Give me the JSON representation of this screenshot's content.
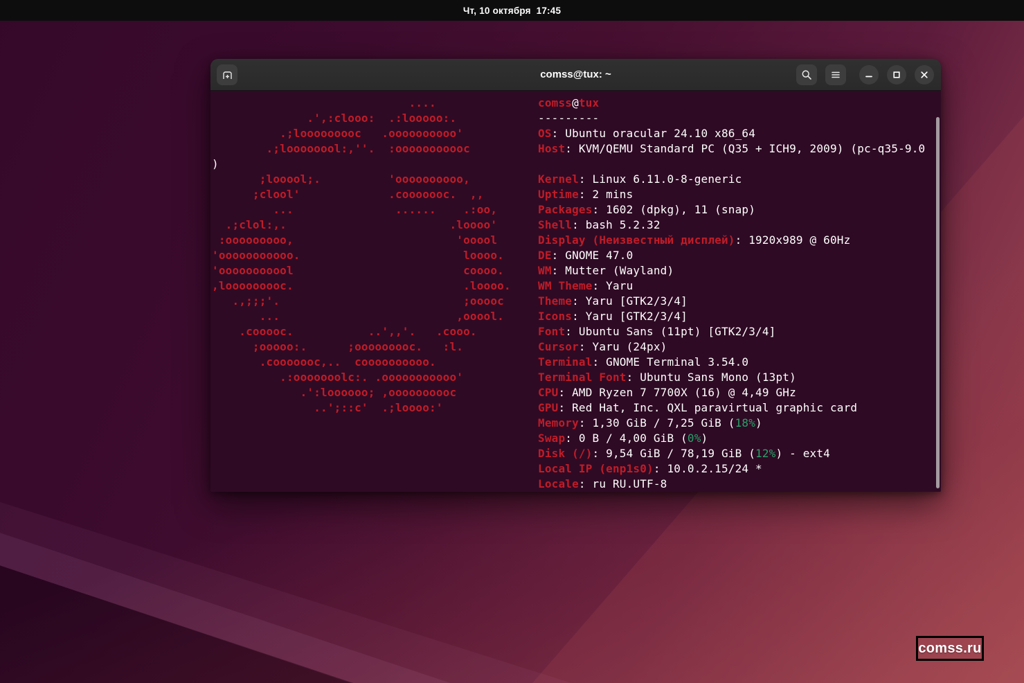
{
  "top_bar": {
    "clock": "Чт, 10 октября  17:45"
  },
  "window": {
    "title": "comss@tux: ~"
  },
  "colors": {
    "terminal_bg": "#2f0a24",
    "ascii_red": "#c01c28",
    "label_red": "#c01c28",
    "foreground": "#ffffff",
    "percent_green": "#26a269",
    "titlebar": "#2c2c2c",
    "topbar": "#0d0d0d"
  },
  "terminal": {
    "host_wrap": ")",
    "ascii_art": [
      "                             ....",
      "              .',:clooo:  .:looooo:.",
      "          .;looooooooc   .oooooooooo'",
      "        .;loooooool:,''.  :ooooooooooc",
      "",
      "       ;looool;.          'oooooooooo,",
      "      ;clool'             .cooooooc.  ,,",
      "         ...               ......    .:oo,",
      "  .;clol:,.                        .loooo'",
      " :ooooooooo,                        'ooool",
      "'ooooooooooo.                        loooo.",
      "'ooooooooool                         coooo.",
      ",looooooooc.                         .loooo.",
      "   .,;;;'.                           ;ooooc",
      "       ...                          ,ooool.",
      "    .cooooc.           ..',,'.   .cooo.",
      "      ;ooooo:.      ;ooooooooc.   :l.",
      "       .cooooooc,..  coooooooooo.",
      "          .:ooooooolc:. .ooooooooooo'",
      "             .':loooooo; ,oooooooooc",
      "               ..';::c'  .;loooo:'"
    ],
    "info_lines": [
      [
        {
          "t": "comss",
          "c": "red"
        },
        {
          "t": "@",
          "c": "fg"
        },
        {
          "t": "tux",
          "c": "red"
        }
      ],
      [
        {
          "t": "---------",
          "c": "fg"
        }
      ],
      [
        {
          "t": "OS",
          "c": "red"
        },
        {
          "t": ": Ubuntu oracular 24.10 x86_64",
          "c": "fg"
        }
      ],
      [
        {
          "t": "Host",
          "c": "red"
        },
        {
          "t": ": KVM/QEMU Standard PC (Q35 + ICH9, 2009) (pc-q35-9.0",
          "c": "fg"
        }
      ],
      [],
      [
        {
          "t": "Kernel",
          "c": "red"
        },
        {
          "t": ": Linux 6.11.0-8-generic",
          "c": "fg"
        }
      ],
      [
        {
          "t": "Uptime",
          "c": "red"
        },
        {
          "t": ": 2 mins",
          "c": "fg"
        }
      ],
      [
        {
          "t": "Packages",
          "c": "red"
        },
        {
          "t": ": 1602 (dpkg), 11 (snap)",
          "c": "fg"
        }
      ],
      [
        {
          "t": "Shell",
          "c": "red"
        },
        {
          "t": ": bash 5.2.32",
          "c": "fg"
        }
      ],
      [
        {
          "t": "Display (Неизвестный дисплей)",
          "c": "red"
        },
        {
          "t": ": 1920x989 @ 60Hz",
          "c": "fg"
        }
      ],
      [
        {
          "t": "DE",
          "c": "red"
        },
        {
          "t": ": GNOME 47.0",
          "c": "fg"
        }
      ],
      [
        {
          "t": "WM",
          "c": "red"
        },
        {
          "t": ": Mutter (Wayland)",
          "c": "fg"
        }
      ],
      [
        {
          "t": "WM Theme",
          "c": "red"
        },
        {
          "t": ": Yaru",
          "c": "fg"
        }
      ],
      [
        {
          "t": "Theme",
          "c": "red"
        },
        {
          "t": ": Yaru [GTK2/3/4]",
          "c": "fg"
        }
      ],
      [
        {
          "t": "Icons",
          "c": "red"
        },
        {
          "t": ": Yaru [GTK2/3/4]",
          "c": "fg"
        }
      ],
      [
        {
          "t": "Font",
          "c": "red"
        },
        {
          "t": ": Ubuntu Sans (11pt) [GTK2/3/4]",
          "c": "fg"
        }
      ],
      [
        {
          "t": "Cursor",
          "c": "red"
        },
        {
          "t": ": Yaru (24px)",
          "c": "fg"
        }
      ],
      [
        {
          "t": "Terminal",
          "c": "red"
        },
        {
          "t": ": GNOME Terminal 3.54.0",
          "c": "fg"
        }
      ],
      [
        {
          "t": "Terminal Font",
          "c": "red"
        },
        {
          "t": ": Ubuntu Sans Mono (13pt)",
          "c": "fg"
        }
      ],
      [
        {
          "t": "CPU",
          "c": "red"
        },
        {
          "t": ": AMD Ryzen 7 7700X (16) @ 4,49 GHz",
          "c": "fg"
        }
      ],
      [
        {
          "t": "GPU",
          "c": "red"
        },
        {
          "t": ": Red Hat, Inc. QXL paravirtual graphic card",
          "c": "fg"
        }
      ],
      [
        {
          "t": "Memory",
          "c": "red"
        },
        {
          "t": ": 1,30 GiB / 7,25 GiB (",
          "c": "fg"
        },
        {
          "t": "18%",
          "c": "green"
        },
        {
          "t": ")",
          "c": "fg"
        }
      ],
      [
        {
          "t": "Swap",
          "c": "red"
        },
        {
          "t": ": 0 B / 4,00 GiB (",
          "c": "fg"
        },
        {
          "t": "0%",
          "c": "green"
        },
        {
          "t": ")",
          "c": "fg"
        }
      ],
      [
        {
          "t": "Disk (/)",
          "c": "red"
        },
        {
          "t": ": 9,54 GiB / 78,19 GiB (",
          "c": "fg"
        },
        {
          "t": "12%",
          "c": "green"
        },
        {
          "t": ") - ext4",
          "c": "fg"
        }
      ],
      [
        {
          "t": "Local IP (enp1s0)",
          "c": "red"
        },
        {
          "t": ": 10.0.2.15/24 *",
          "c": "fg"
        }
      ],
      [
        {
          "t": "Locale",
          "c": "red"
        },
        {
          "t": ": ru RU.UTF-8",
          "c": "fg"
        }
      ]
    ]
  },
  "watermark": {
    "text": "comss.ru"
  }
}
